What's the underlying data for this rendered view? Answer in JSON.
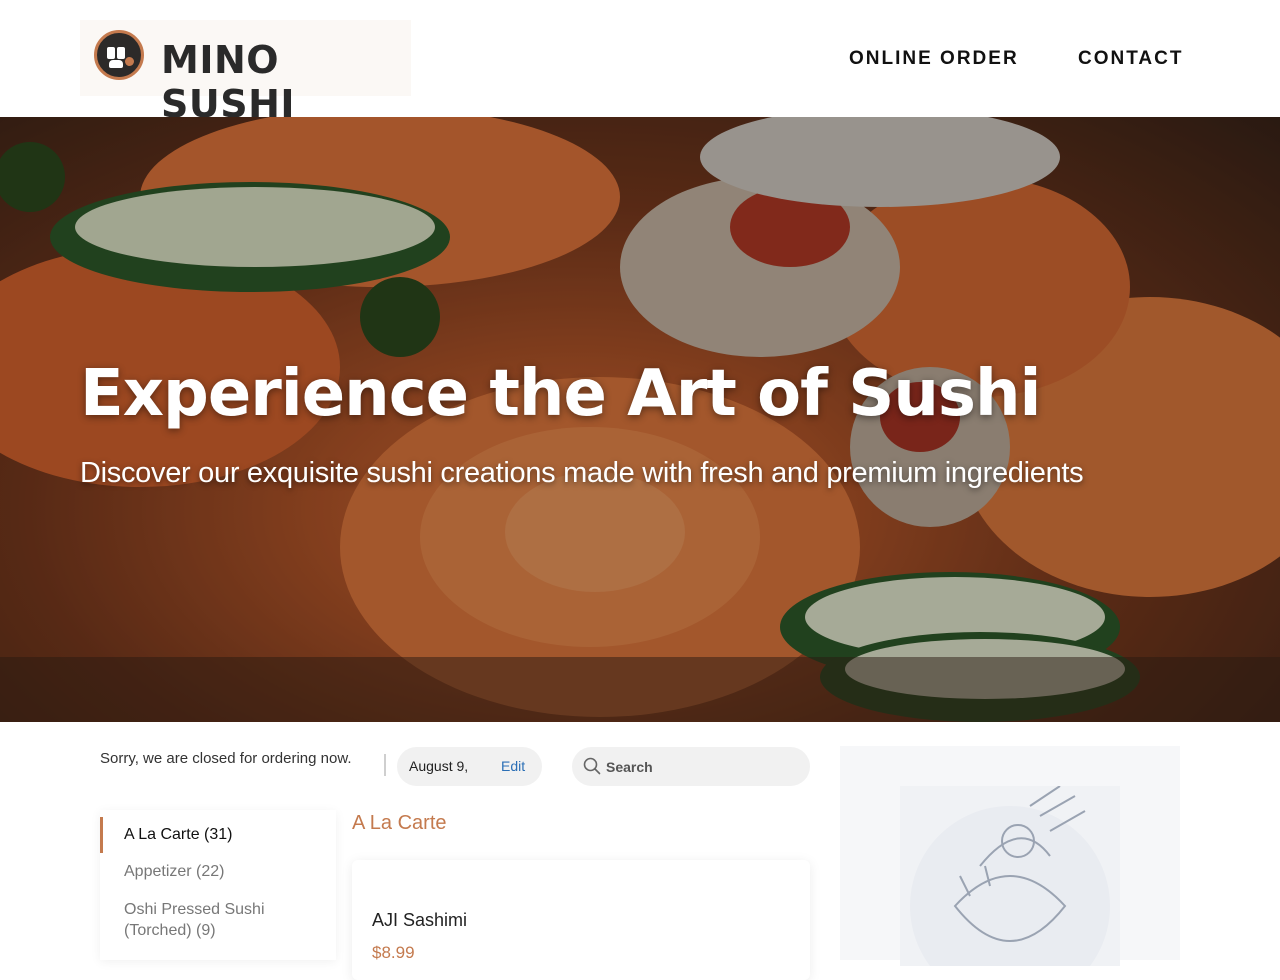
{
  "header": {
    "logo_text": "MINO SUSHI",
    "nav": [
      {
        "label": "ONLINE ORDER"
      },
      {
        "label": "CONTACT"
      }
    ]
  },
  "hero": {
    "title": "Experience the Art of Sushi",
    "subtitle": "Discover our exquisite sushi creations made with fresh and premium ingredients"
  },
  "ordering": {
    "status": "Sorry, we are closed for ordering now.",
    "date": "August 9,",
    "edit_label": "Edit",
    "search_placeholder": "Search"
  },
  "categories": [
    {
      "label": "A La Carte (31)",
      "active": true
    },
    {
      "label": "Appetizer (22)",
      "active": false
    },
    {
      "label": "Oshi Pressed Sushi (Torched) (9)",
      "active": false
    }
  ],
  "section": {
    "title": "A La Carte",
    "items": [
      {
        "name": "AJI Sashimi",
        "price": "$8.99"
      }
    ]
  },
  "colors": {
    "accent": "#c47a4e",
    "link": "#2b6fb6"
  },
  "icons": [
    "logo-mark-icon",
    "search-icon",
    "empty-cart-illustration-icon"
  ]
}
